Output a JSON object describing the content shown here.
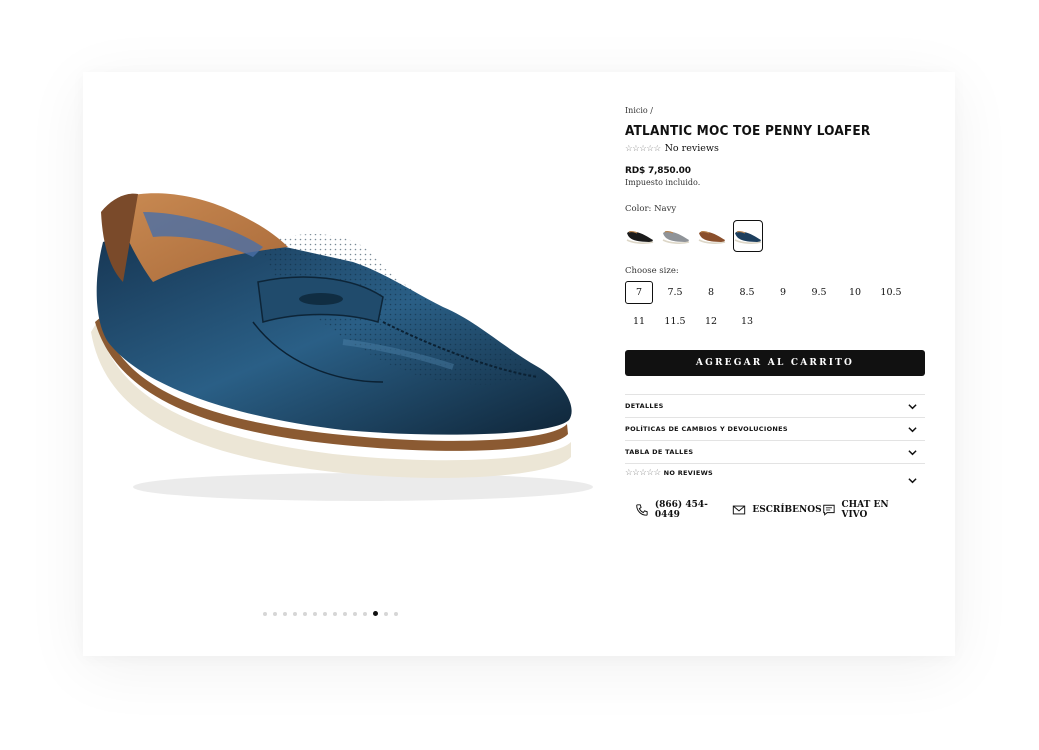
{
  "breadcrumb": "Inicio /",
  "product": {
    "title": "ATLANTIC MOC TOE PENNY LOAFER",
    "stars": "☆☆☆☆☆",
    "reviews_text": "No reviews",
    "price": "RD$ 7,850.00",
    "tax_note": "Impuesto incluido."
  },
  "color": {
    "label": "Color: Navy",
    "swatches": [
      {
        "name": "black",
        "color": "#1b1b1b",
        "selected": false
      },
      {
        "name": "gray",
        "color": "#8f9398",
        "selected": false
      },
      {
        "name": "cognac",
        "color": "#8a4f2c",
        "selected": false
      },
      {
        "name": "navy",
        "color": "#1d3f5e",
        "selected": true
      }
    ]
  },
  "sizes": {
    "label": "Choose size:",
    "options": [
      "7",
      "7.5",
      "8",
      "8.5",
      "9",
      "9.5",
      "10",
      "10.5",
      "11",
      "11.5",
      "12",
      "13"
    ],
    "selected": "7"
  },
  "add_to_cart": "AGREGAR AL CARRITO",
  "accordion": {
    "details": "DETALLES",
    "policies": "POLÍTICAS DE CAMBIOS Y DEVOLUCIONES",
    "size_chart": "TABLA DE TALLES",
    "reviews_stars": "☆☆☆☆☆",
    "reviews": "NO REVIEWS"
  },
  "contact": {
    "phone": "(866) 454-0449",
    "email": "ESCRÍBENOS",
    "chat": "CHAT EN VIVO"
  },
  "gallery": {
    "total_images": 14,
    "active_index": 11
  },
  "colors": {
    "button_bg": "#111111",
    "shoe_upper": "#1f4b6e",
    "shoe_sole": "#ece6d6",
    "shoe_welt": "#8b5a32"
  }
}
